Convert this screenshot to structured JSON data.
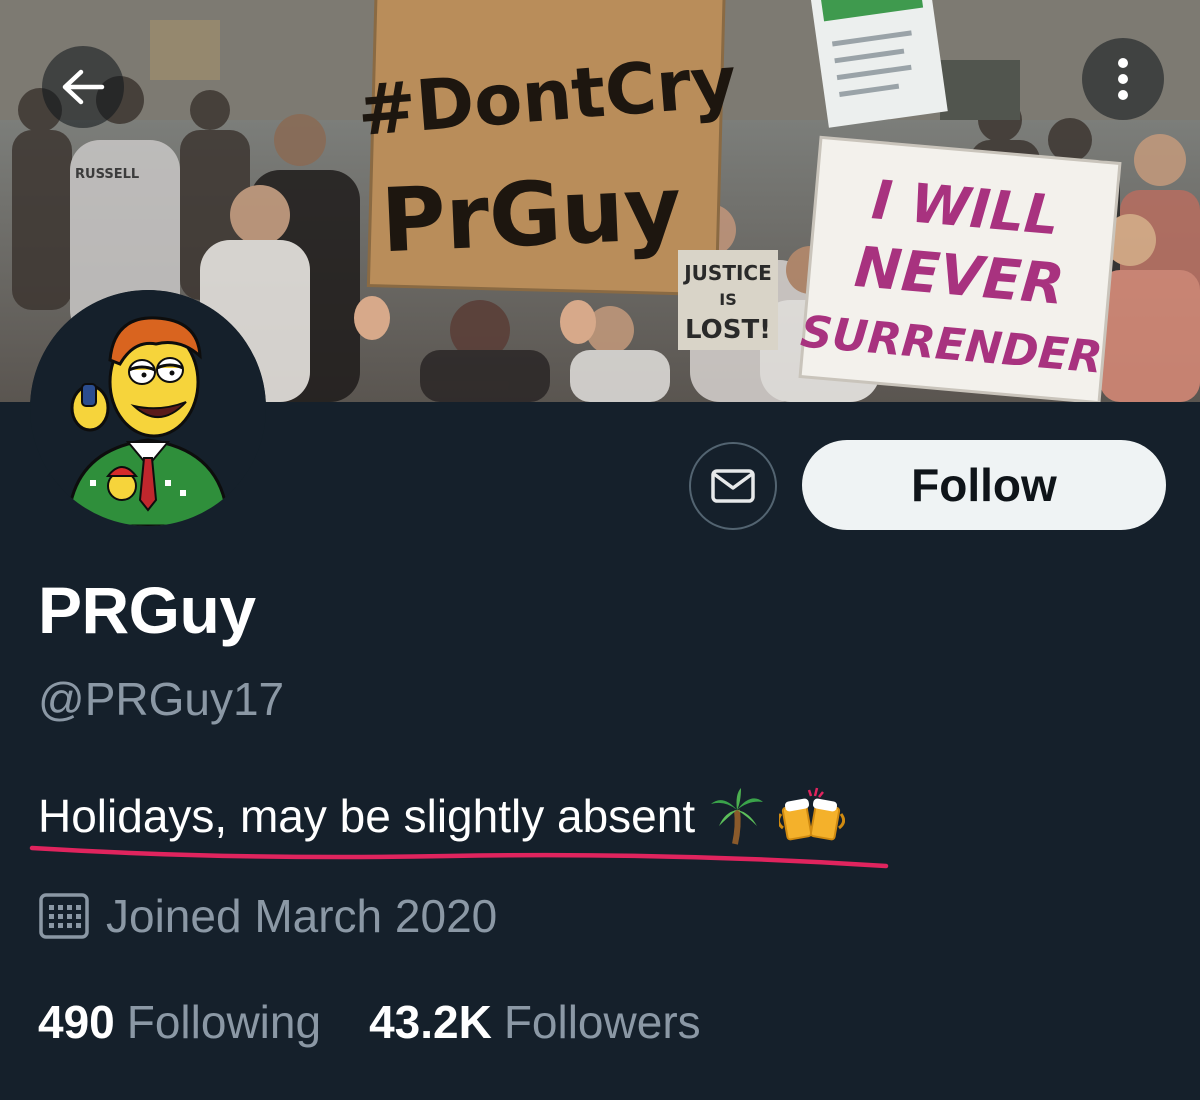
{
  "banner": {
    "signs": {
      "left_sign_line1": "#DontCry",
      "left_sign_line2": "PrGuy",
      "right_sign_line1": "I WILL",
      "right_sign_line2": "NEVER",
      "right_sign_line3": "SURRENDER",
      "small_sign_line1": "JUSTICE",
      "small_sign_line2": "IS",
      "small_sign_line3": "LOST!",
      "shirt_text": "RUSSELL"
    }
  },
  "nav": {
    "back_icon": "arrow-left-icon",
    "more_icon": "more-vertical-icon"
  },
  "actions": {
    "message_icon": "envelope-icon",
    "follow_label": "Follow"
  },
  "profile": {
    "display_name": "PRGuy",
    "handle": "@PRGuy17",
    "bio": "Holidays, may be slightly absent",
    "bio_emojis": [
      "palm-tree-emoji",
      "clinking-beer-mugs-emoji"
    ],
    "joined": "Joined March 2020",
    "following_count": "490",
    "following_label": "Following",
    "followers_count": "43.2K",
    "followers_label": "Followers"
  },
  "colors": {
    "background": "#15202b",
    "secondary_text": "#8b98a5",
    "follow_bg": "#eff3f4",
    "annotation_underline": "#e0245e"
  }
}
